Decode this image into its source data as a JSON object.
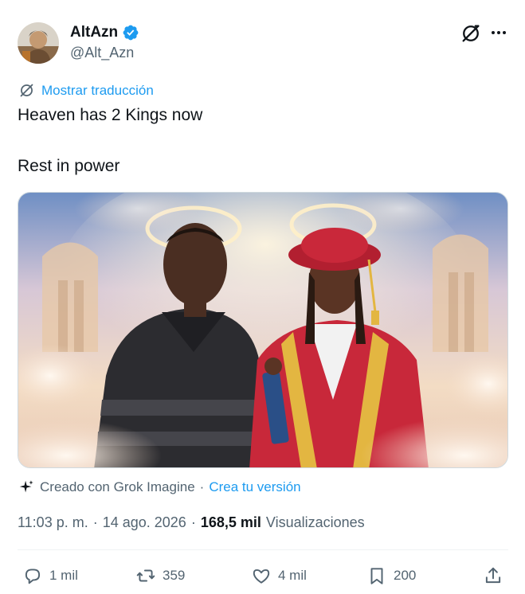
{
  "author": {
    "display_name": "AltAzn",
    "handle": "@Alt_Azn",
    "verified": true,
    "verified_color": "#1d9bf0"
  },
  "header_icons": [
    "grok-icon",
    "more-icon"
  ],
  "translate": {
    "label": "Mostrar traducción",
    "icon": "translate-icon"
  },
  "tweet": {
    "line1": "Heaven has 2 Kings now",
    "line2": "Rest in power"
  },
  "media": {
    "type": "image",
    "description_icon": "ai-generated-image"
  },
  "grok_attribution": {
    "text": "Creado con Grok Imagine",
    "separator": "·",
    "link": "Crea tu versión"
  },
  "meta": {
    "time": "11:03 p. m.",
    "sep1": "·",
    "date": "14 ago. 2026",
    "sep2": "·",
    "views_count": "168,5 mil",
    "views_label": "Visualizaciones"
  },
  "actions": {
    "replies": "1 mil",
    "reposts": "359",
    "likes": "4 mil",
    "bookmarks": "200"
  },
  "colors": {
    "accent": "#1d9bf0",
    "secondary_text": "#536471",
    "primary_text": "#0f1419"
  }
}
